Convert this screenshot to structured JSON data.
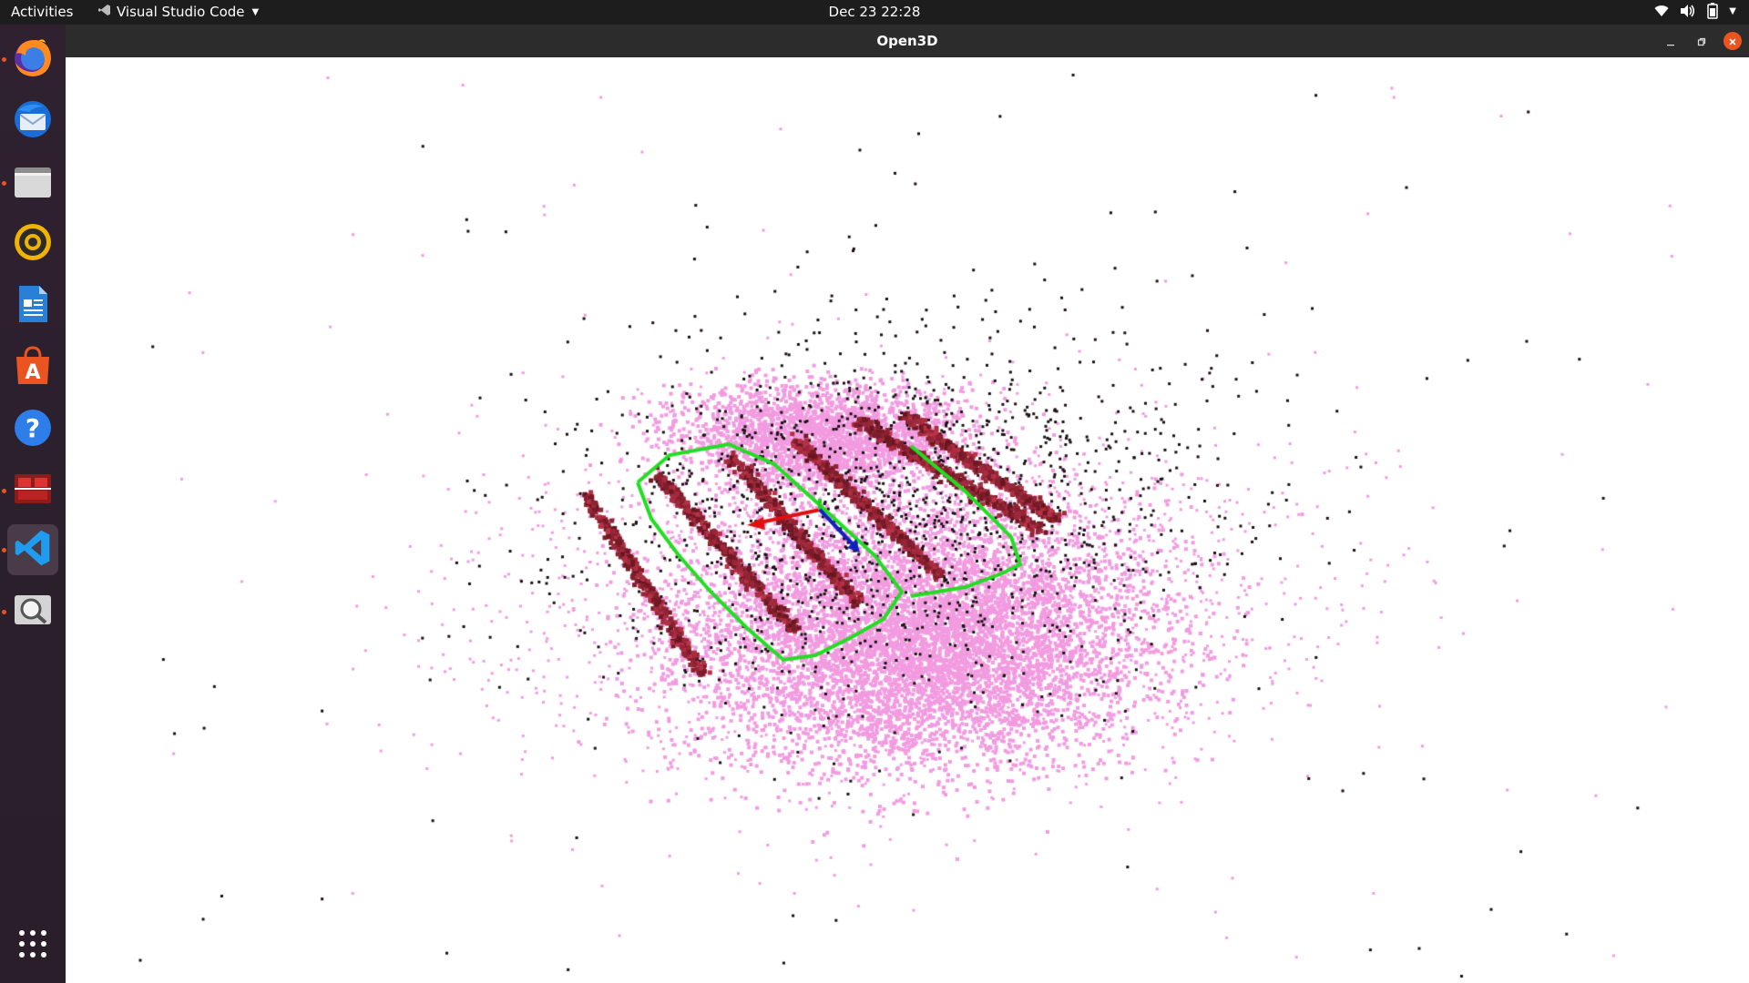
{
  "topbar": {
    "activities_label": "Activities",
    "app_name": "Visual Studio Code",
    "clock": "Dec 23  22:28",
    "tray_icons": [
      "wifi-icon",
      "volume-icon",
      "battery-icon",
      "system-menu-caret-icon"
    ]
  },
  "dock": {
    "items": [
      {
        "name": "firefox",
        "icon": "firefox-icon",
        "running": true
      },
      {
        "name": "thunderbird",
        "icon": "thunderbird-icon",
        "running": false
      },
      {
        "name": "files",
        "icon": "files-icon",
        "running": true
      },
      {
        "name": "rhythmbox",
        "icon": "rhythmbox-icon",
        "running": false
      },
      {
        "name": "libreoffice-writer",
        "icon": "writer-icon",
        "running": false
      },
      {
        "name": "ubuntu-software",
        "icon": "software-icon",
        "running": false
      },
      {
        "name": "help",
        "icon": "help-icon",
        "running": false
      },
      {
        "name": "open3d-app",
        "icon": "open3d-app-icon",
        "running": true
      },
      {
        "name": "vscode",
        "icon": "vscode-icon",
        "running": true,
        "active": true
      },
      {
        "name": "image-viewer",
        "icon": "magnifier-icon",
        "running": true
      }
    ],
    "app_grid_icon": "show-applications-icon"
  },
  "window": {
    "title": "Open3D",
    "controls": [
      "minimize-icon",
      "maximize-icon",
      "close-icon"
    ]
  },
  "colors": {
    "topbar": "#1d1d1d",
    "dock": "#2b1f2a",
    "accent": "#e95420",
    "point_pink": "#f29be0",
    "point_dark": "#1a0f14",
    "trajectory": "#22dd22",
    "axis_x": "#e01010",
    "axis_y": "#22cc22",
    "axis_z": "#1020c0"
  }
}
